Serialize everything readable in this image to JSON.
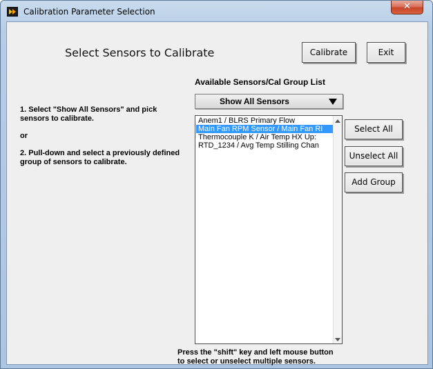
{
  "window": {
    "title": "Calibration Parameter Selection",
    "close_label": "✕"
  },
  "main": {
    "heading": "Select Sensors to Calibrate",
    "calibrate_label": "Calibrate",
    "exit_label": "Exit",
    "list_label": "Available Sensors/Cal Group List",
    "dropdown_value": "Show All Sensors",
    "instructions": {
      "step1": "1. Select \"Show All Sensors\" and pick sensors to calibrate.",
      "or": "or",
      "step2": "2. Pull-down and select a previously defined group of sensors to calibrate."
    },
    "sensors": [
      {
        "label": "Anem1 / BLRS Primary Flow",
        "selected": false
      },
      {
        "label": "Main Fan RPM Sensor / Main Fan RI",
        "selected": true
      },
      {
        "label": "Thermocouple K / Air Temp HX Up:",
        "selected": false
      },
      {
        "label": "RTD_1234 / Avg Temp Stilling Chan",
        "selected": false
      }
    ],
    "select_all_label": "Select All",
    "unselect_all_label": "Unselect All",
    "add_group_label": "Add Group",
    "footer_line1": "Press the \"shift\" key and left mouse button",
    "footer_line2": "to select or unselect multiple sensors."
  },
  "colors": {
    "selection": "#3399ff",
    "close_button": "#c8452a"
  }
}
